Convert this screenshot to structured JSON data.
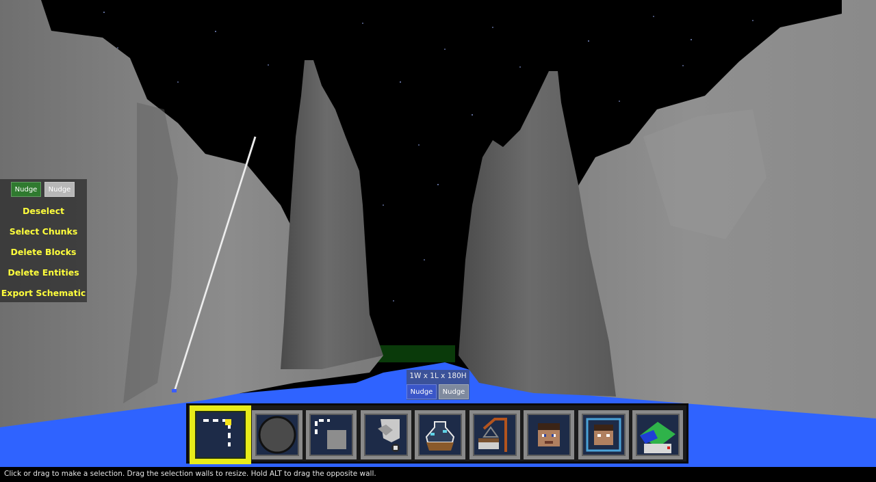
{
  "tool_panel": {
    "nudge_left": "Nudge",
    "nudge_right": "Nudge",
    "items": [
      "Deselect",
      "Select Chunks",
      "Delete Blocks",
      "Delete Entities",
      "Export Schematic"
    ]
  },
  "selection": {
    "size_text": "1W x 1L x 180H",
    "nudge_left": "Nudge",
    "nudge_right": "Nudge"
  },
  "hotbar": {
    "selected_index": 0,
    "slots": [
      "select-tool-icon",
      "brush-tool-icon",
      "clone-tool-icon",
      "fill-tool-icon",
      "filter-tool-icon",
      "crane-tool-icon",
      "player-head-icon",
      "player-spawn-icon",
      "world-map-icon"
    ]
  },
  "status": {
    "text": "Click or drag to make a selection. Drag the selection walls to resize. Hold ALT to drag the opposite wall."
  },
  "colors": {
    "panel_text": "#ffff3c",
    "hotbar_selected": "#e8ec1a",
    "water": "#2f63ff",
    "rock": "#7f7f7f"
  }
}
